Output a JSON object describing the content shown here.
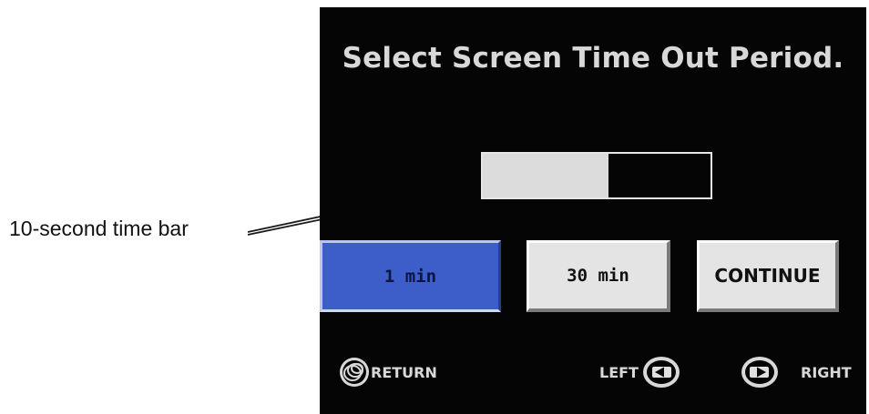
{
  "annotation": {
    "label": "10-second time bar"
  },
  "screen": {
    "title": "Select Screen Time Out Period.",
    "timebar": {
      "progress": 0.55
    },
    "buttons": {
      "one_min": "1 min",
      "thirty_min": "30 min",
      "continue": "CONTINUE"
    },
    "nav": {
      "return_label": "RETURN",
      "left_label": "LEFT",
      "right_label": "RIGHT"
    }
  },
  "colors": {
    "screen_bg": "#050505",
    "selected_button": "#3d5ec8",
    "button_bg": "#e4e4e4",
    "text_light": "#d8d8d8"
  },
  "icons": [
    "return-icon",
    "left-arrow-icon",
    "right-arrow-icon"
  ]
}
